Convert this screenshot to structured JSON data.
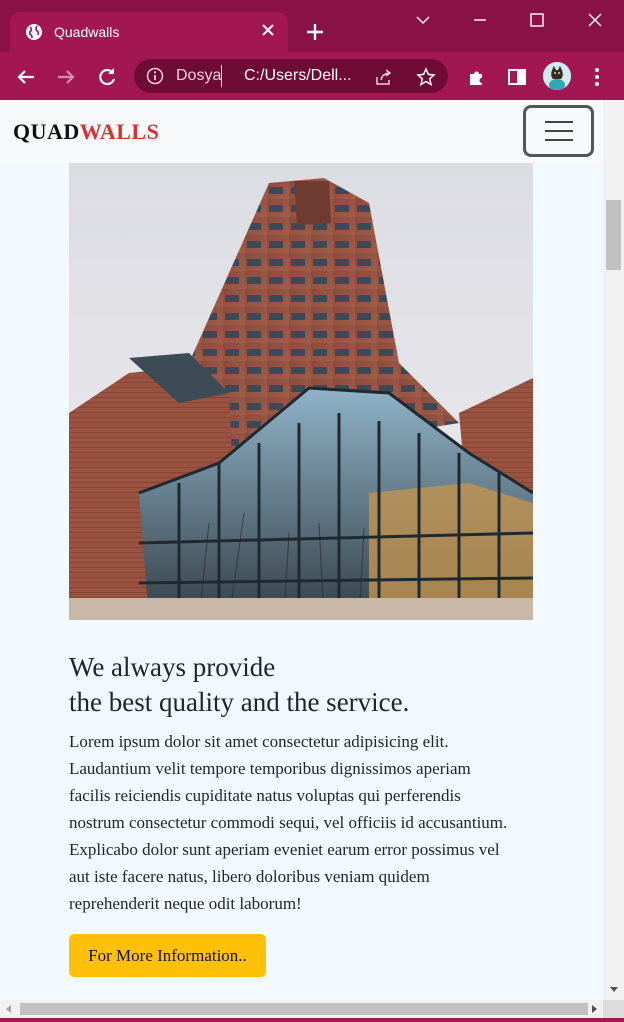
{
  "browser": {
    "tab_title": "Quadwalls",
    "omnibox": {
      "security_label": "Dosya",
      "url": "C:/Users/Dell..."
    },
    "colors": {
      "frame": "#8a1145",
      "toolbar": "#a21651",
      "omnibox": "#6d0b34"
    }
  },
  "page": {
    "brand": {
      "part1": "QUAD",
      "part2": "WALLS",
      "accent_color": "#dc2f35"
    },
    "headline_line1": "We always provide",
    "headline_line2": "the best quality and the service.",
    "body_lines": [
      "Lorem ipsum dolor sit amet consectetur adipisicing elit.",
      "Laudantium velit tempore temporibus dignissimos aperiam",
      "facilis reiciendis cupiditate natus voluptas qui perferendis",
      "nostrum consectetur commodi sequi, vel officiis id accusantium.",
      "Explicabo dolor sunt aperiam eveniet earum error possimus vel",
      "aut iste facere natus, libero doloribus veniam quidem",
      "reprehenderit neque odit laborum!"
    ],
    "cta_label": "For More Information..",
    "cta_color": "#ffc107",
    "hero_image": "photo-of-glass-and-brick-skyscraper"
  },
  "icons": {
    "tab": "globe-icon",
    "close": "close-icon",
    "new_tab": "plus-icon",
    "back": "back-arrow-icon",
    "forward": "forward-arrow-icon",
    "reload": "reload-icon",
    "info": "info-icon",
    "share": "share-icon",
    "bookmark": "star-icon",
    "extensions": "puzzle-icon",
    "side_panel": "side-panel-icon",
    "menu": "kebab-menu-icon",
    "hamburger": "hamburger-menu-icon"
  }
}
